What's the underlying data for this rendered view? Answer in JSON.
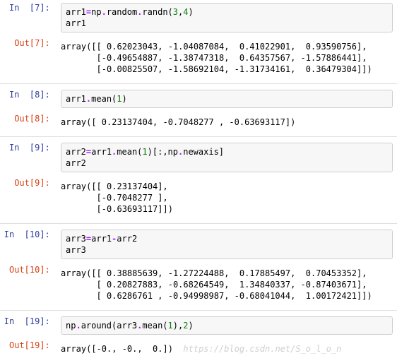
{
  "cells": [
    {
      "in_prompt": "In  [7]: ",
      "out_prompt": "Out[7]: ",
      "code_raw": "arr1=np.random.randn(3,4)\narr1",
      "output": "array([[ 0.62023043, -1.04087084,  0.41022901,  0.93590756],\n       [-0.49654887, -1.38747318,  0.64357567, -1.57886441],\n       [-0.00825507, -1.58692104, -1.31734161,  0.36479304]])"
    },
    {
      "in_prompt": "In  [8]: ",
      "out_prompt": "Out[8]: ",
      "code_raw": "arr1.mean(1)",
      "output": "array([ 0.23137404, -0.7048277 , -0.63693117])"
    },
    {
      "in_prompt": "In  [9]: ",
      "out_prompt": "Out[9]: ",
      "code_raw": "arr2=arr1.mean(1)[:,np.newaxis]\narr2",
      "output": "array([[ 0.23137404],\n       [-0.7048277 ],\n       [-0.63693117]])"
    },
    {
      "in_prompt": "In  [10]: ",
      "out_prompt": "Out[10]: ",
      "code_raw": "arr3=arr1-arr2\narr3",
      "output": "array([[ 0.38885639, -1.27224488,  0.17885497,  0.70453352],\n       [ 0.20827883, -0.68264549,  1.34840337, -0.87403671],\n       [ 0.6286761 , -0.94998987, -0.68041044,  1.00172421]])"
    },
    {
      "in_prompt": "In  [19]: ",
      "out_prompt": "Out[19]: ",
      "code_raw": "np.around(arr3.mean(1),2)",
      "output": "array([-0., -0.,  0.])",
      "watermark": "  https://blog.csdn.net/S_o_l_o_n"
    }
  ],
  "code_html": [
    "arr1<span class='tok-op'>=</span>np<span class='tok-op'>.</span>random<span class='tok-op'>.</span>randn(<span class='tok-num'>3</span>,<span class='tok-num'>4</span>)\narr1",
    "arr1<span class='tok-op'>.</span>mean(<span class='tok-num'>1</span>)",
    "arr2<span class='tok-op'>=</span>arr1<span class='tok-op'>.</span>mean(<span class='tok-num'>1</span>)[:,np<span class='tok-op'>.</span>newaxis]\narr2",
    "arr3<span class='tok-op'>=</span>arr1<span class='tok-op'>-</span>arr2\narr3",
    "np<span class='tok-op'>.</span>around(arr3<span class='tok-op'>.</span>mean(<span class='tok-num'>1</span>),<span class='tok-num'>2</span>)"
  ]
}
